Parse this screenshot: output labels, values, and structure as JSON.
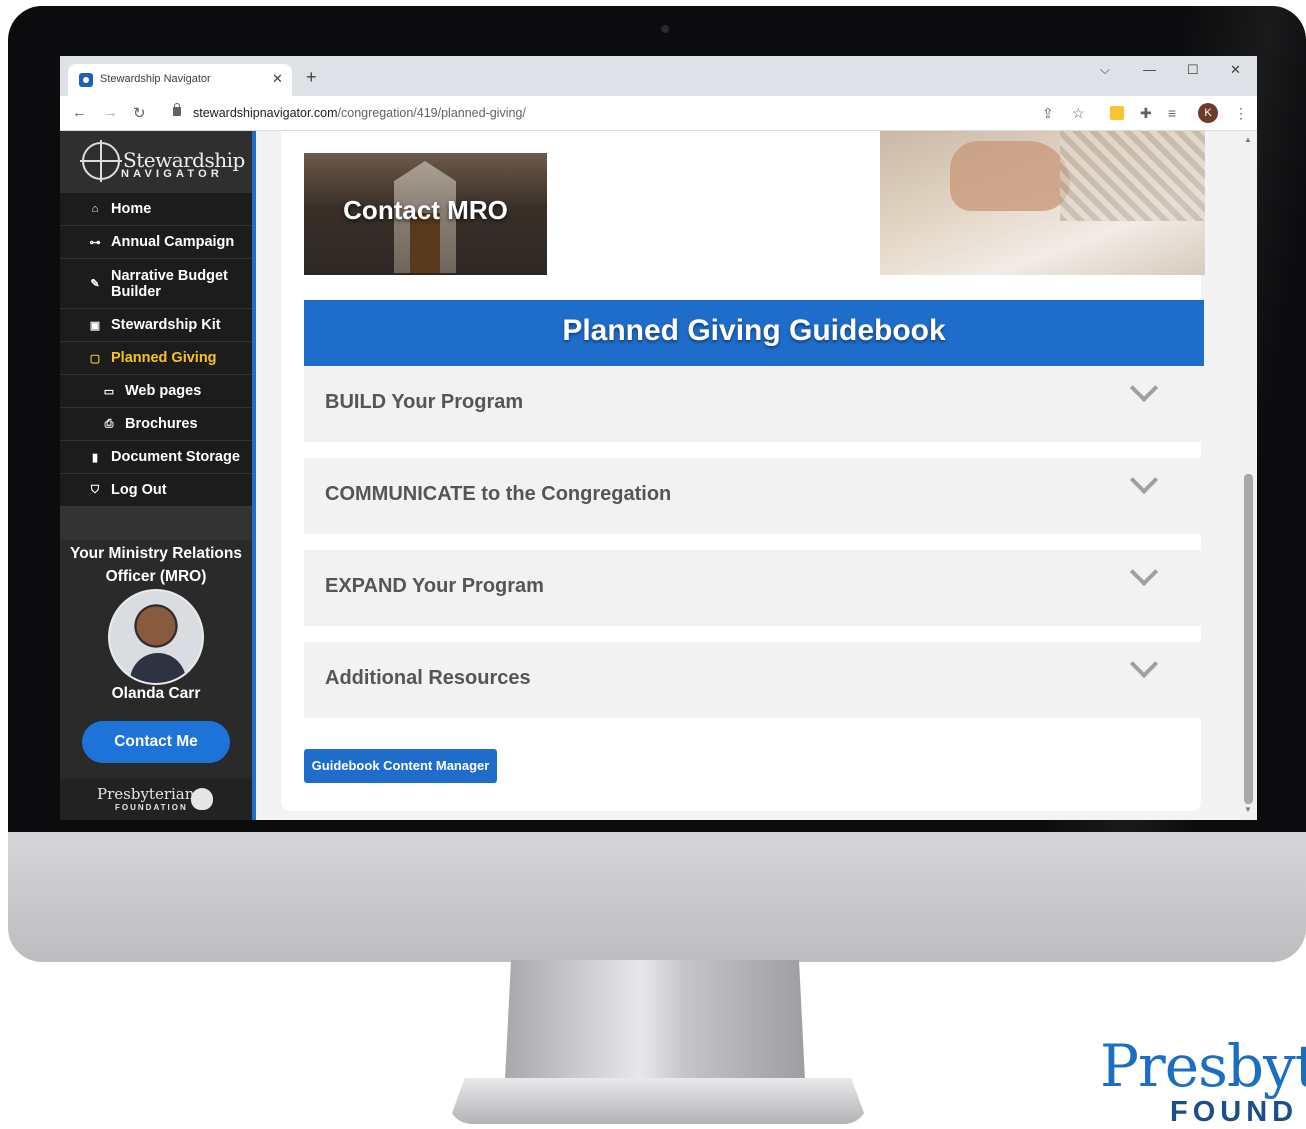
{
  "browser": {
    "tab_title": "Stewardship Navigator",
    "url_host": "stewardshipnavigator.com",
    "url_path": "/congregation/419/planned-giving/",
    "profile_initial": "K"
  },
  "sidebar": {
    "logo_word": "Stewardship",
    "logo_sub": "NAVIGATOR",
    "items": [
      {
        "label": "Home",
        "icon": "home-icon"
      },
      {
        "label": "Annual Campaign",
        "icon": "key-icon"
      },
      {
        "label": "Narrative Budget Builder",
        "icon": "pencil-icon"
      },
      {
        "label": "Stewardship Kit",
        "icon": "images-icon"
      },
      {
        "label": "Planned Giving",
        "icon": "calendar-icon",
        "active": true
      },
      {
        "label": "Web pages",
        "icon": "window-icon"
      },
      {
        "label": "Brochures",
        "icon": "print-icon"
      },
      {
        "label": "Document Storage",
        "icon": "bookmark-icon"
      },
      {
        "label": "Log Out",
        "icon": "shield-check-icon"
      }
    ],
    "mro_title": "Your Ministry Relations Officer (MRO)",
    "mro_name": "Olanda Carr",
    "contact_button": "Contact Me",
    "footer_word": "Presbyterian",
    "footer_sub": "FOUNDATION"
  },
  "main": {
    "hero_caption": "Contact MRO",
    "guidebook_title": "Planned Giving Guidebook",
    "accordion": [
      {
        "label": "BUILD Your Program"
      },
      {
        "label": "COMMUNICATE to the Congregation"
      },
      {
        "label": "EXPAND Your Program"
      },
      {
        "label": "Additional Resources"
      }
    ],
    "content_manager_button": "Guidebook Content Manager"
  },
  "brand": {
    "word": "Presbyte",
    "sub": "FOUND"
  },
  "colors": {
    "accent_blue": "#1f6dcb",
    "active_yellow": "#f5c518",
    "sidebar_bg": "#2a2a2a"
  }
}
